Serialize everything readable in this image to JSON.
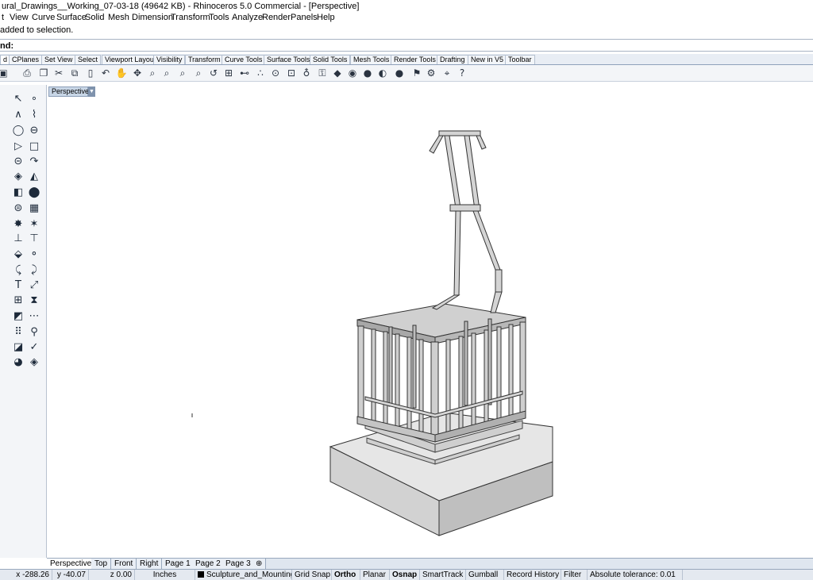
{
  "window": {
    "title": "ural_Drawings__Working_07-03-18 (49642 KB) - Rhinoceros 5.0 Commercial - [Perspective]"
  },
  "menu": [
    "t",
    "View",
    "Curve",
    "Surface",
    "Solid",
    "Mesh",
    "Dimension",
    "Transform",
    "Tools",
    "Analyze",
    "Render",
    "Panels",
    "Help"
  ],
  "command": {
    "history": "added to selection.",
    "prompt": "nd:"
  },
  "toolbar_tabs": [
    "d",
    "CPlanes",
    "Set View",
    "Select",
    "Viewport Layout",
    "Visibility",
    "Transform",
    "Curve Tools",
    "Surface Tools",
    "Solid Tools",
    "Mesh Tools",
    "Render Tools",
    "Drafting",
    "New in V5",
    "Toolbar"
  ],
  "viewport": {
    "active_label": "Perspective",
    "dropdown_glyph": "▼"
  },
  "viewport_tabs": [
    "Perspective",
    "Top",
    "Front",
    "Right",
    "Page 1",
    "Page 2",
    "Page 3",
    "⊕"
  ],
  "status": {
    "x": "x -288.26",
    "y": "y -40.07",
    "z": "z 0.00",
    "units": "Inches",
    "layer": "Sculpture_and_Mounting_P",
    "grid_snap": "Grid Snap",
    "ortho": "Ortho",
    "planar": "Planar",
    "osnap": "Osnap",
    "smarttrack": "SmartTrack",
    "gumball": "Gumball",
    "record_history": "Record History",
    "filter": "Filter",
    "tolerance": "Absolute tolerance: 0.01"
  },
  "colors": {
    "chrome_bg": "#f3f5f8",
    "tab_bg": "#e8edf4",
    "active_tab": "#c8d6e6",
    "viewport_bg": "#ffffff",
    "model_base": "#c9c9c9",
    "model_cage": "#bdbdbd"
  }
}
